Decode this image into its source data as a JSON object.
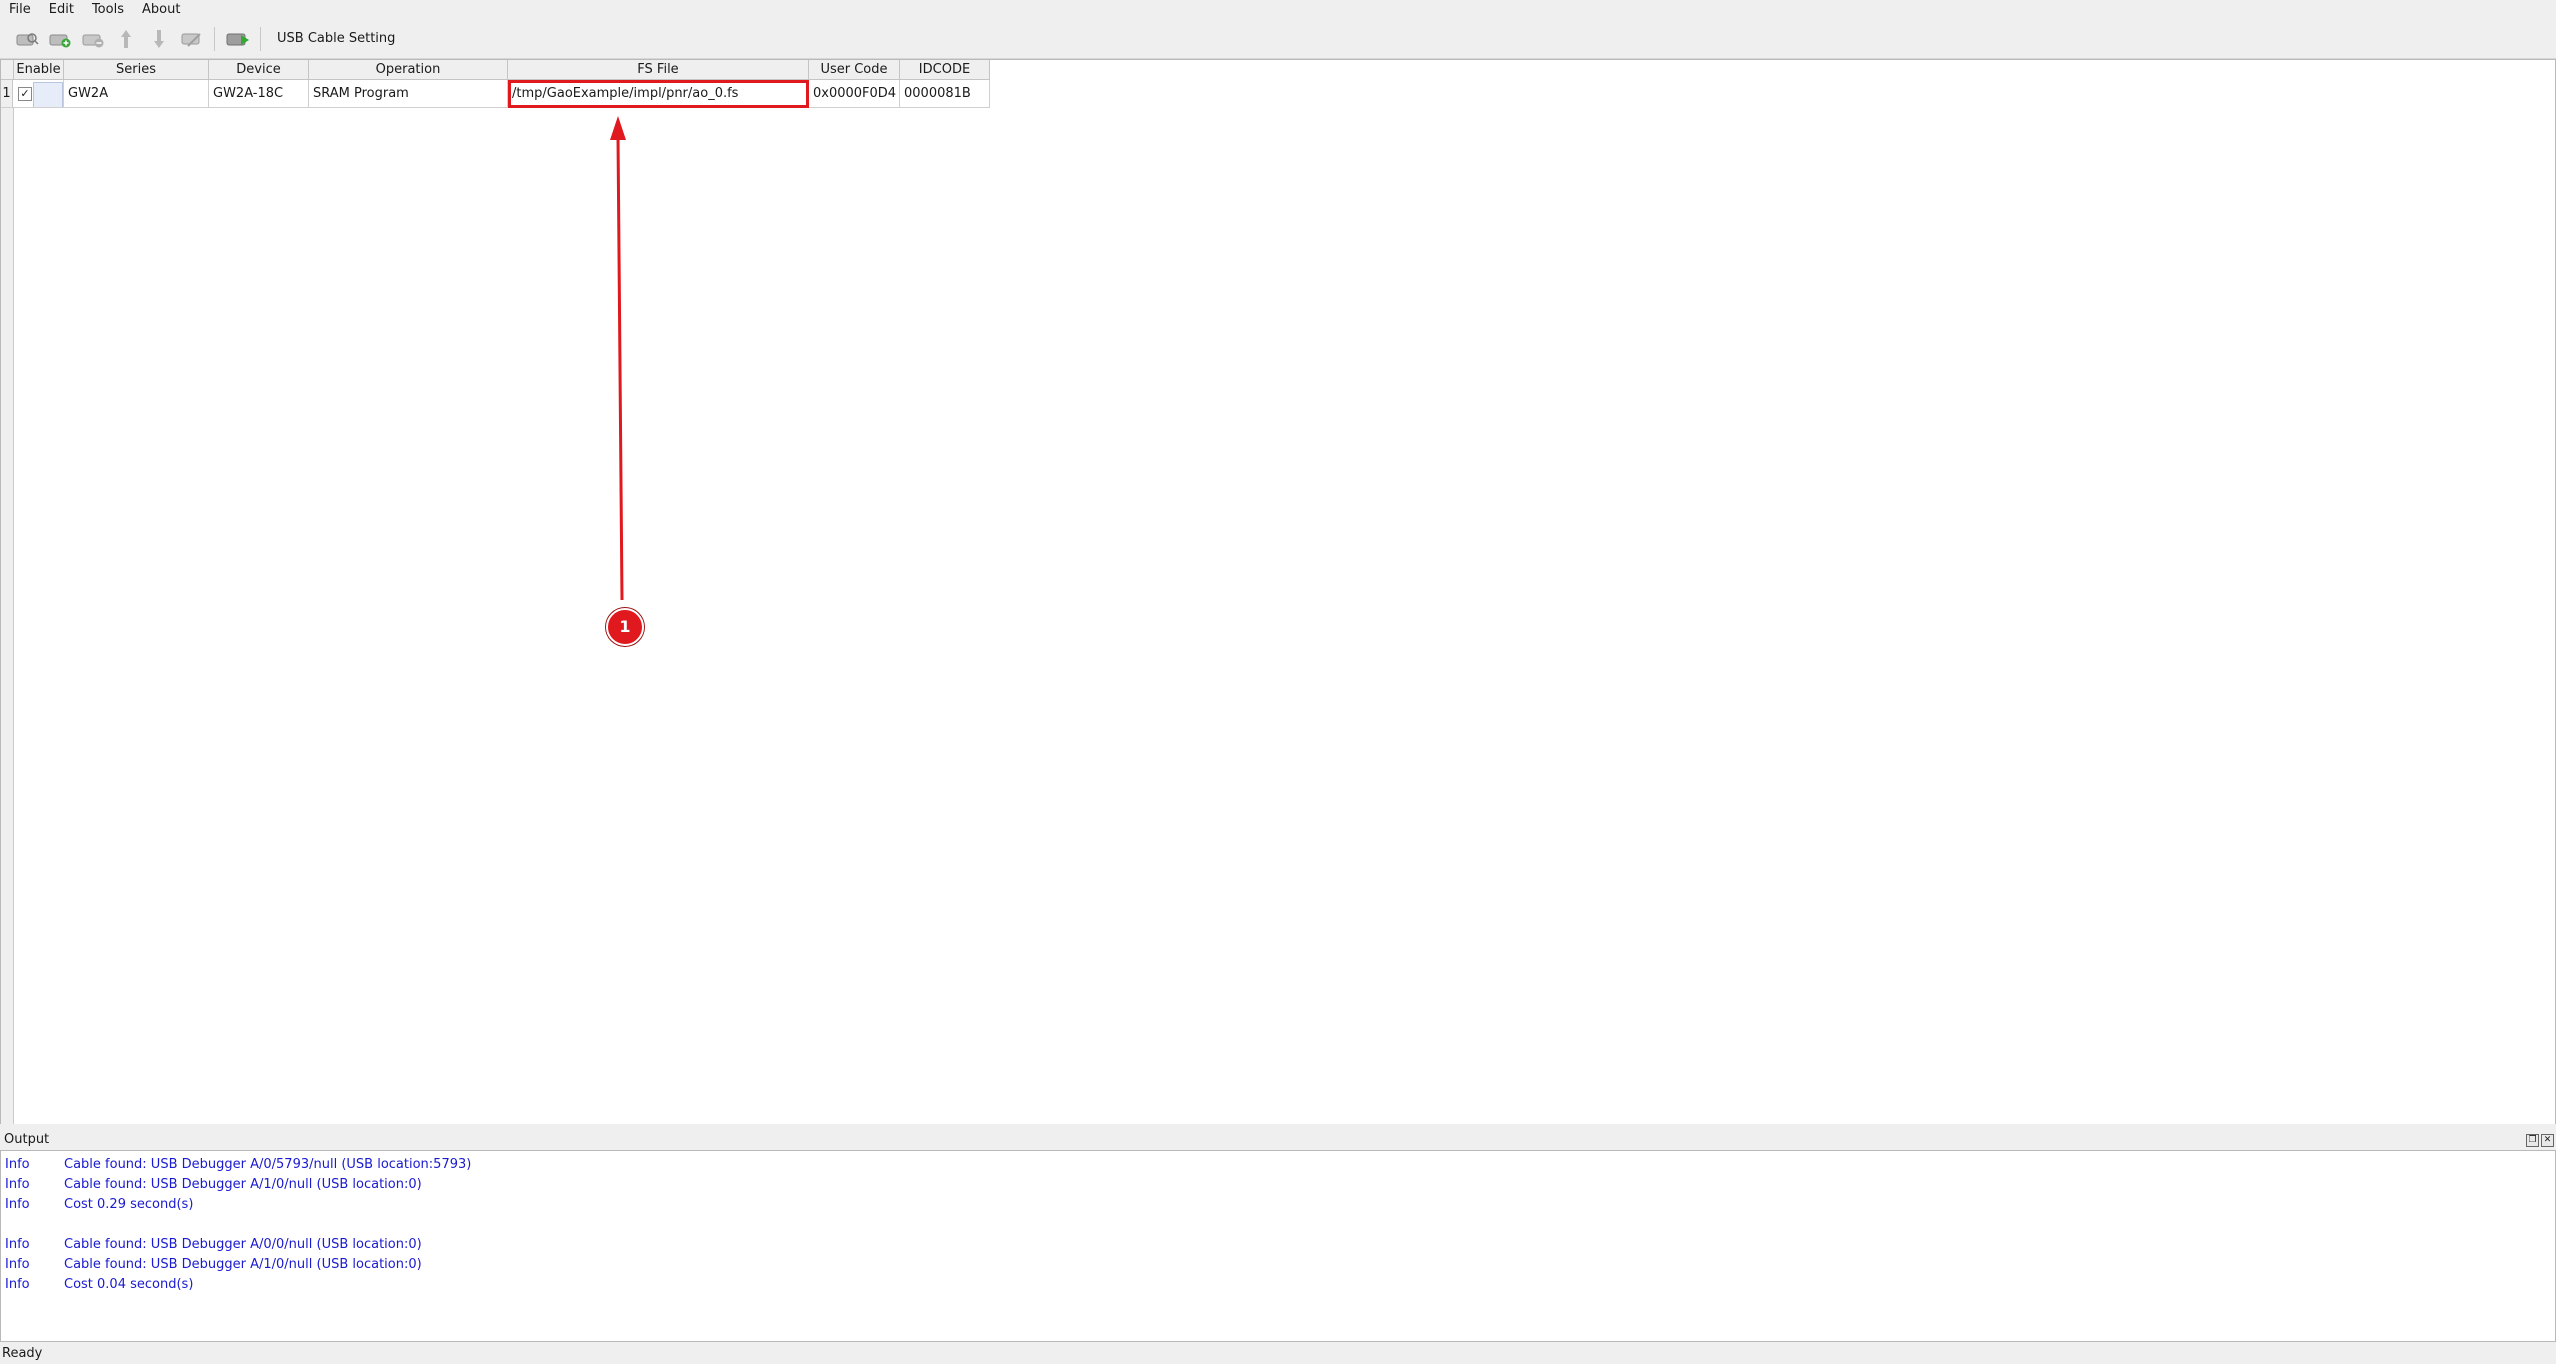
{
  "menubar": {
    "items": [
      "File",
      "Edit",
      "Tools",
      "About"
    ]
  },
  "toolbar": {
    "icons": [
      "scan-device-icon",
      "add-device-icon",
      "remove-device-icon",
      "move-up-icon",
      "move-down-icon",
      "edit-device-icon",
      "program-config-icon"
    ],
    "usb_cable_setting_label": "USB Cable Setting"
  },
  "table": {
    "headers": {
      "enable": "Enable",
      "series": "Series",
      "device": "Device",
      "operation": "Operation",
      "fs_file": "FS File",
      "user_code": "User Code",
      "idcode": "IDCODE"
    },
    "rows": [
      {
        "num": "1",
        "enabled_mark": "✓",
        "series": "GW2A",
        "device": "GW2A-18C",
        "operation": "SRAM Program",
        "fs_file": "/tmp/GaoExample/impl/pnr/ao_0.fs",
        "user_code": "0x0000F0D4",
        "idcode": "0000081B"
      }
    ]
  },
  "annotation": {
    "marker_label": "1",
    "color": "#e0191e"
  },
  "output": {
    "title": "Output",
    "lines": [
      {
        "level": "Info",
        "message": "Cable found:  USB Debugger A/0/5793/null (USB location:5793)"
      },
      {
        "level": "Info",
        "message": "Cable found:  USB Debugger A/1/0/null (USB location:0)"
      },
      {
        "level": "Info",
        "message": "Cost 0.29 second(s)"
      },
      {
        "level": "Info",
        "message": "Cable found:  USB Debugger A/0/0/null (USB location:0)"
      },
      {
        "level": "Info",
        "message": "Cable found:  USB Debugger A/1/0/null (USB location:0)"
      },
      {
        "level": "Info",
        "message": "Cost 0.04 second(s)"
      }
    ],
    "log_color": "#1a1ad0"
  },
  "statusbar": {
    "text": "Ready"
  }
}
